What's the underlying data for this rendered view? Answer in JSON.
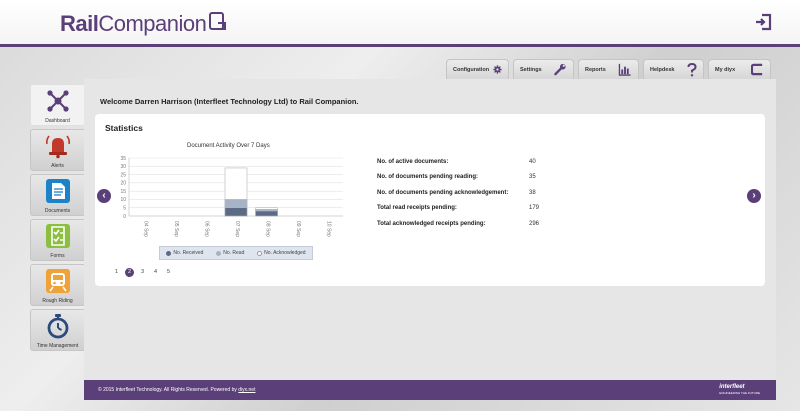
{
  "header": {
    "logo_rail": "Rail",
    "logo_companion": "Companion",
    "brand_color": "#5b3f79"
  },
  "tabs": [
    {
      "label": "Configuration",
      "icon": "gear-icon"
    },
    {
      "label": "Settings",
      "icon": "wrench-icon"
    },
    {
      "label": "Reports",
      "icon": "bar-chart-icon"
    },
    {
      "label": "Helpdesk",
      "icon": "question-icon"
    },
    {
      "label": "My diyx",
      "icon": "diyx-logo-icon"
    }
  ],
  "sidebar": {
    "items": [
      {
        "label": "Dashboard",
        "icon": "network-icon",
        "active": true
      },
      {
        "label": "Alerts",
        "icon": "alarm-bell-icon"
      },
      {
        "label": "Documents",
        "icon": "document-icon"
      },
      {
        "label": "Forms",
        "icon": "checklist-icon"
      },
      {
        "label": "Rough Riding",
        "icon": "train-icon"
      },
      {
        "label": "Time Management",
        "icon": "stopwatch-icon"
      }
    ]
  },
  "main": {
    "welcome": "Welcome Darren Harrison (Interfleet Technology Ltd) to Rail Companion.",
    "statistics_title": "Statistics",
    "prev_arrow": "‹",
    "next_arrow": "›"
  },
  "chart_data": {
    "type": "bar",
    "title": "Document Activity Over 7 Days",
    "categories": [
      "04 Sep",
      "05 Sep",
      "06 Sep",
      "07 Sep",
      "08 Sep",
      "09 Sep",
      "10 Sep"
    ],
    "series": [
      {
        "name": "No. Received",
        "values": [
          0,
          0,
          0,
          29,
          5,
          0,
          0
        ],
        "color": "#ffffff"
      },
      {
        "name": "No. Read",
        "values": [
          0,
          0,
          0,
          10,
          4,
          0,
          0
        ],
        "color": "#a7b3c6"
      },
      {
        "name": "No. Acknowledged",
        "values": [
          0,
          0,
          0,
          5,
          3,
          0,
          0
        ],
        "color": "#5c6a84"
      }
    ],
    "yticks": [
      0,
      5,
      10,
      15,
      20,
      25,
      30,
      35
    ],
    "ylim": [
      0,
      35
    ],
    "grid": true,
    "legend_position": "bottom"
  },
  "pagination": {
    "pages": [
      "1",
      "2",
      "3",
      "4",
      "5"
    ],
    "active": "2"
  },
  "stats": [
    {
      "label": "No. of active documents:",
      "value": "40"
    },
    {
      "label": "No. of documents pending reading:",
      "value": "35"
    },
    {
      "label": "No. of documents pending acknowledgement:",
      "value": "38"
    },
    {
      "label": "Total read receipts pending:",
      "value": "179"
    },
    {
      "label": "Total acknowledged receipts pending:",
      "value": "296"
    }
  ],
  "footer": {
    "copyright": "© 2015 Interfleet Technology. All Rights Reserved. Powered by ",
    "powered_link": "diyx.net",
    "logo_text": "interfleet",
    "logo_sub": "ENGINEERING THE FUTURE"
  }
}
